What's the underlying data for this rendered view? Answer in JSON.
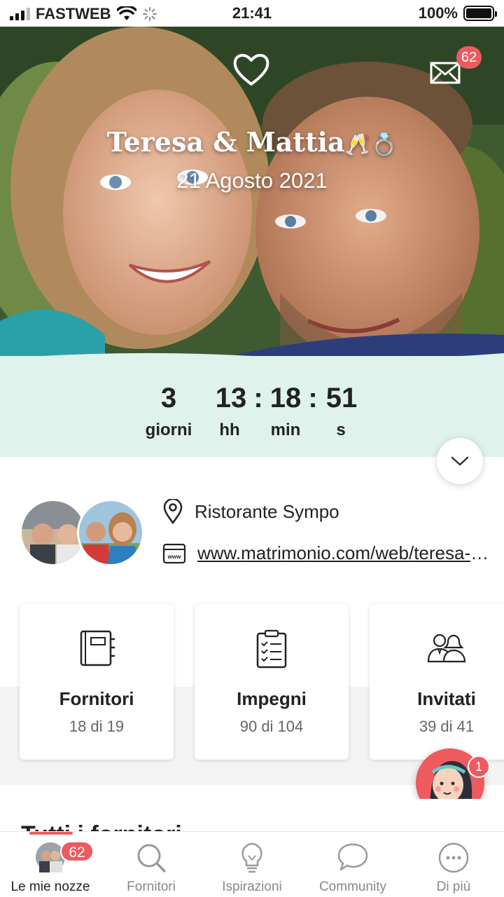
{
  "status_bar": {
    "carrier": "FASTWEB",
    "time": "21:41",
    "battery": "100%"
  },
  "hero": {
    "couple_name": "Teresa & Mattia",
    "couple_emoji": "🥂💍",
    "date": "21 Agosto 2021",
    "mail_badge": "62"
  },
  "countdown": {
    "days": "3",
    "hours": "13",
    "minutes": "18",
    "seconds": "51",
    "separator": ":",
    "labels": {
      "days": "giorni",
      "hours": "hh",
      "minutes": "min",
      "seconds": "s"
    }
  },
  "info": {
    "venue": "Ristorante Sympo",
    "website": "www.matrimonio.com/web/teresa-mattia"
  },
  "cards": [
    {
      "title": "Fornitori",
      "count": "18 di 19",
      "icon": "notebook-icon"
    },
    {
      "title": "Impegni",
      "count": "90 di 104",
      "icon": "checklist-icon"
    },
    {
      "title": "Invitati",
      "count": "39 di 41",
      "icon": "guests-icon"
    }
  ],
  "assistant_badge": "1",
  "section_peek": "Tutti i fornitori",
  "tabbar": {
    "badge": "62",
    "items": [
      {
        "label": "Le mie nozze",
        "icon": "avatar-icon"
      },
      {
        "label": "Fornitori",
        "icon": "search-icon"
      },
      {
        "label": "Ispirazioni",
        "icon": "lightbulb-icon"
      },
      {
        "label": "Community",
        "icon": "chat-bubble-icon"
      },
      {
        "label": "Di più",
        "icon": "more-dots-icon"
      }
    ]
  },
  "colors": {
    "accent": "#ef5a5f",
    "countdown_bg": "#dff2ec"
  }
}
